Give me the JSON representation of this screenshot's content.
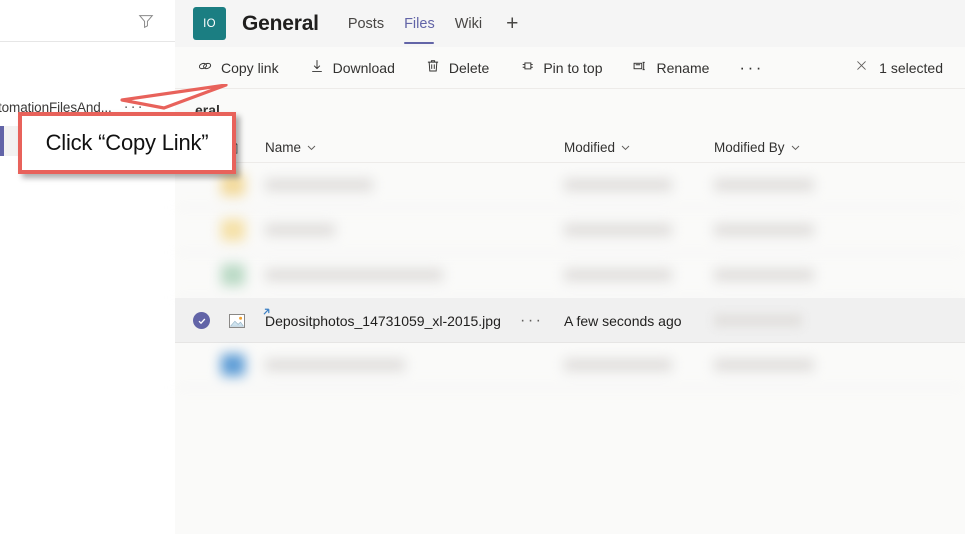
{
  "sidebar": {
    "filter_icon": "funnel-icon",
    "item_label": "tomationFilesAnd...",
    "overflow_label": "···"
  },
  "header": {
    "avatar_initials": "IO",
    "channel_name": "General",
    "tabs": [
      {
        "label": "Posts",
        "active": false
      },
      {
        "label": "Files",
        "active": true
      },
      {
        "label": "Wiki",
        "active": false
      }
    ],
    "add_tab_label": "+",
    "accent_color": "#6264a7",
    "avatar_color": "#1b7e82"
  },
  "command_bar": {
    "items": [
      {
        "label": "Copy link",
        "icon": "link-icon"
      },
      {
        "label": "Download",
        "icon": "download-icon"
      },
      {
        "label": "Delete",
        "icon": "trash-icon"
      },
      {
        "label": "Pin to top",
        "icon": "pin-icon"
      },
      {
        "label": "Rename",
        "icon": "rename-icon"
      }
    ],
    "overflow_label": "···",
    "close_icon": "close-icon",
    "selection_text": "1 selected"
  },
  "breadcrumb": {
    "current": "eral"
  },
  "file_list": {
    "columns": [
      {
        "label": "Name"
      },
      {
        "label": "Modified"
      },
      {
        "label": "Modified By"
      }
    ],
    "rows": [
      {
        "name": "",
        "modified": "",
        "modified_by": "",
        "icon": "folder-icon",
        "icon_color": "#f2d99a",
        "blurred": true,
        "selected": false,
        "name_width": 108
      },
      {
        "name": "",
        "modified": "",
        "modified_by": "",
        "icon": "folder-icon",
        "icon_color": "#f5e0a6",
        "blurred": true,
        "selected": false,
        "name_width": 70
      },
      {
        "name": "",
        "modified": "",
        "modified_by": "",
        "icon": "excel-icon",
        "icon_color": "#b9d9c4",
        "blurred": true,
        "selected": false,
        "name_width": 178
      },
      {
        "name": "Depositphotos_14731059_xl-2015.jpg",
        "modified": "A few seconds ago",
        "modified_by": "",
        "icon": "image-icon",
        "icon_color": "#ffffff",
        "blurred": false,
        "selected": true,
        "row_menu": "···",
        "new_badge": "new-file-icon"
      },
      {
        "name": "",
        "modified": "",
        "modified_by": "",
        "icon": "word-icon",
        "icon_color": "#5b9bd5",
        "blurred": true,
        "selected": false,
        "name_width": 140
      }
    ]
  },
  "annotation": {
    "text": "Click “Copy Link”",
    "border_color": "#e8625b"
  }
}
